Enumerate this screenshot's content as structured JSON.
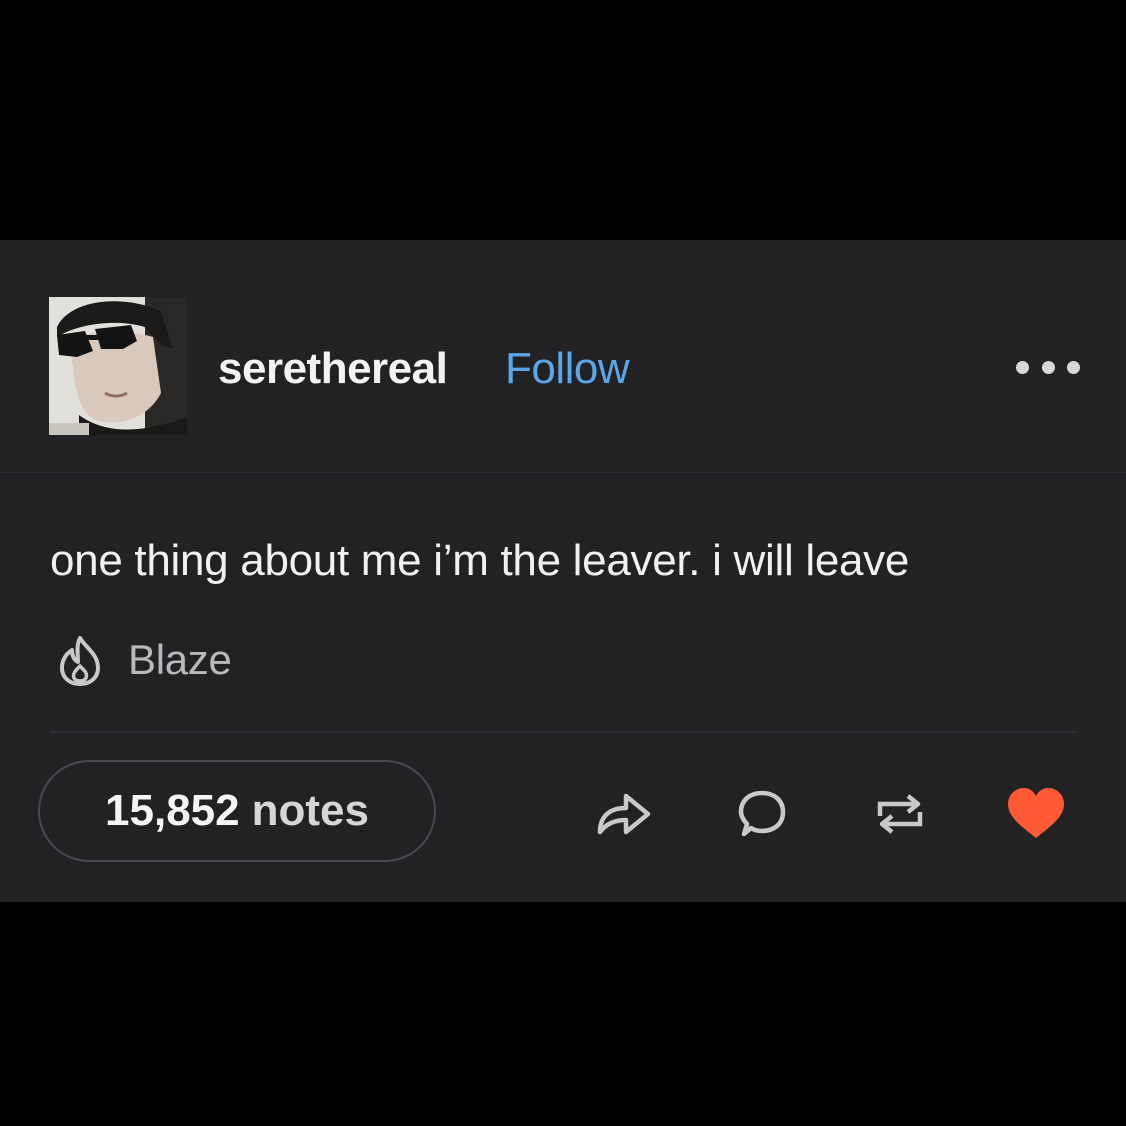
{
  "post": {
    "username": "serethereal",
    "follow_label": "Follow",
    "more_icon": "more-horizontal-icon",
    "body": "one thing about me i’m the leaver. i will leave",
    "blaze_label": "Blaze",
    "blaze_icon": "flame-icon",
    "notes_count": "15,852",
    "notes_label": "notes"
  },
  "actions": [
    {
      "name": "share",
      "icon": "share-arrow-icon"
    },
    {
      "name": "reply",
      "icon": "speech-bubble-icon"
    },
    {
      "name": "reblog",
      "icon": "reblog-icon"
    },
    {
      "name": "like",
      "icon": "heart-icon",
      "active": true
    }
  ],
  "colors": {
    "background": "#000000",
    "card": "#222124",
    "follow_link": "#5aa6e6",
    "liked_heart": "#ff5a36",
    "icon_gray": "#c9c9cb"
  }
}
